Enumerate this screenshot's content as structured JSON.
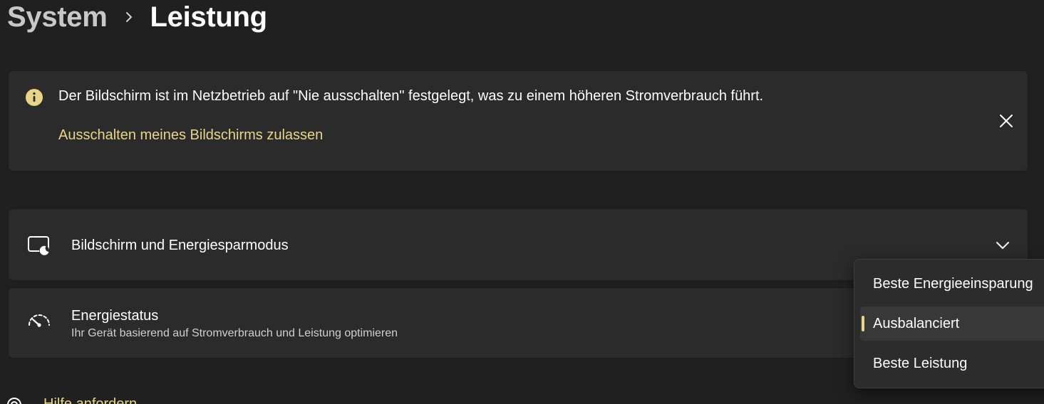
{
  "breadcrumb": {
    "parent": "System",
    "separator_icon": "chevron-right-icon",
    "current": "Leistung"
  },
  "banner": {
    "icon": "info-icon",
    "message": "Der Bildschirm ist im Netzbetrieb auf \"Nie ausschalten\" festgelegt, was zu einem höheren Stromverbrauch führt.",
    "link": "Ausschalten meines Bildschirms zulassen",
    "close_icon": "close-icon"
  },
  "settings": {
    "display": {
      "icon": "display-sleep-icon",
      "title": "Bildschirm und Energiesparmodus",
      "expand_icon": "chevron-down-icon"
    },
    "power_mode": {
      "icon": "speedometer-icon",
      "title": "Energiestatus",
      "subtitle": "Ihr Gerät basierend auf Stromverbrauch und Leistung optimieren"
    }
  },
  "power_mode_dropdown": {
    "options": [
      {
        "label": "Beste Energieeinsparung"
      },
      {
        "label": "Ausbalanciert"
      },
      {
        "label": "Beste Leistung"
      }
    ],
    "selected": "Ausbalanciert"
  },
  "help": {
    "icon": "help-icon",
    "link": "Hilfe anfordern"
  },
  "colors": {
    "background": "#202020",
    "card": "#2b2b2b",
    "accent": "#e8d58a"
  }
}
